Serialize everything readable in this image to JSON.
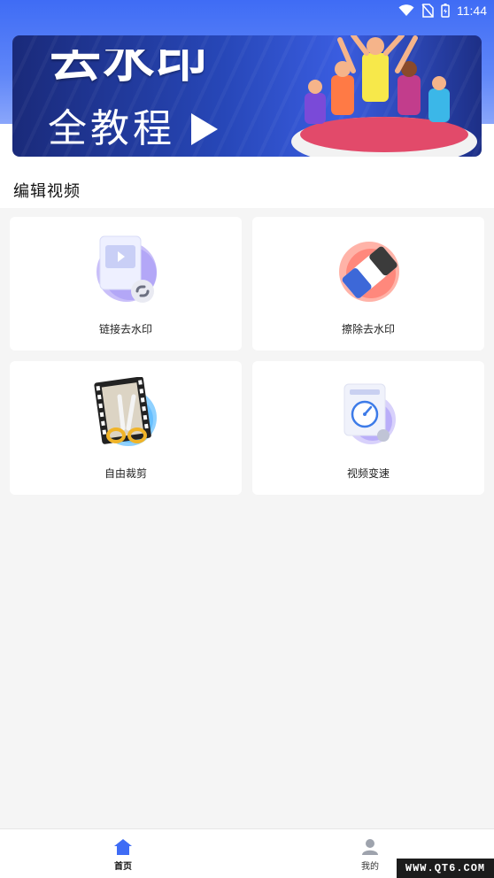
{
  "status_bar": {
    "time": "11:44"
  },
  "banner": {
    "line1": "去水印",
    "line2": "全教程",
    "icon": "play-icon"
  },
  "section": {
    "title": "编辑视频"
  },
  "tools": [
    {
      "label": "链接去水印",
      "icon": "link-video-icon",
      "accent": "#8b7cf6"
    },
    {
      "label": "擦除去水印",
      "icon": "eraser-icon",
      "accent": "#ff6a5f"
    },
    {
      "label": "自由裁剪",
      "icon": "scissors-film-icon",
      "accent": "#4cb3ff"
    },
    {
      "label": "视频变速",
      "icon": "speedometer-icon",
      "accent": "#9b8cf7"
    }
  ],
  "bottom_nav": {
    "home": {
      "label": "首页",
      "icon": "home-icon",
      "active": true
    },
    "mine": {
      "label": "我的",
      "icon": "user-icon",
      "active": false
    }
  },
  "watermark": "WWW.QT6.COM",
  "colors": {
    "primary": "#3f6cf5",
    "background": "#f5f5f5"
  }
}
